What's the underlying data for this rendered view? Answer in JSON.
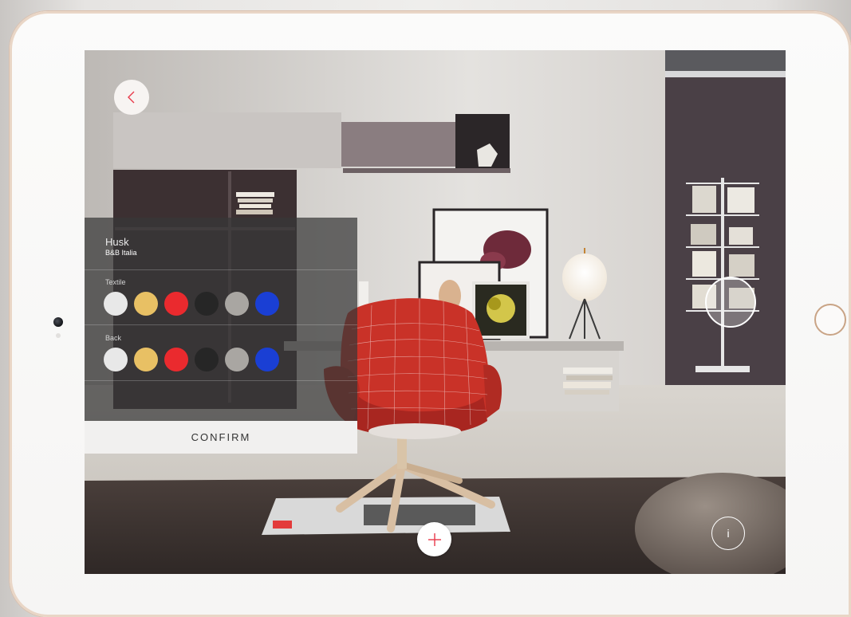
{
  "product": {
    "name": "Husk",
    "brand": "B&B Italia"
  },
  "options": [
    {
      "label": "Textile",
      "colors": [
        "#e8e8e8",
        "#e8c064",
        "#ea2a2e",
        "#262626",
        "#a9a6a2",
        "#1a3fd4"
      ]
    },
    {
      "label": "Back",
      "colors": [
        "#e8e8e8",
        "#e8c064",
        "#ea2a2e",
        "#262626",
        "#a9a6a2",
        "#1a3fd4"
      ]
    }
  ],
  "actions": {
    "confirm_label": "CONFIRM",
    "info_symbol": "i"
  },
  "icons": {
    "back": "chevron-left-icon",
    "add": "plus-icon",
    "info": "info-icon",
    "capture": "capture-icon",
    "home": "home-button-icon"
  },
  "colors": {
    "accent": "#e8394a"
  }
}
